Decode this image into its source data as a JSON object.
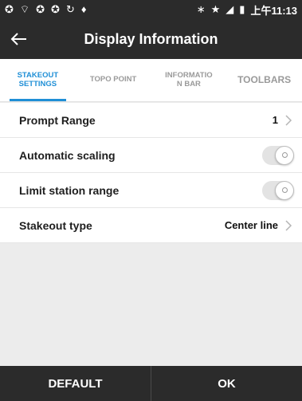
{
  "status_bar": {
    "left_icons": [
      "chrome-icon",
      "wifi-icon",
      "chrome-icon",
      "chrome-icon",
      "sync-icon",
      "location-icon"
    ],
    "right_icons": [
      "bluetooth-icon",
      "star-icon",
      "no-signal-icon",
      "battery-icon"
    ],
    "time": "上午11:13"
  },
  "app_bar": {
    "title": "Display Information",
    "back_icon": "arrow-left-icon"
  },
  "tabs": [
    {
      "label": "STAKEOUT\nSETTINGS",
      "active": true
    },
    {
      "label": "TOPO POINT",
      "active": false
    },
    {
      "label": "INFORMATIO\nN BAR",
      "active": false
    },
    {
      "label": "TOOLBARS",
      "active": false
    }
  ],
  "rows": {
    "prompt_range": {
      "label": "Prompt Range",
      "value": "1"
    },
    "automatic_scaling": {
      "label": "Automatic scaling",
      "on": false
    },
    "limit_station_range": {
      "label": "Limit station range",
      "on": false
    },
    "stakeout_type": {
      "label": "Stakeout type",
      "value": "Center line"
    }
  },
  "bottom": {
    "default_label": "DEFAULT",
    "ok_label": "OK"
  },
  "colors": {
    "accent": "#1f8fd6",
    "bar": "#2b2b2b",
    "background": "#ececec"
  }
}
